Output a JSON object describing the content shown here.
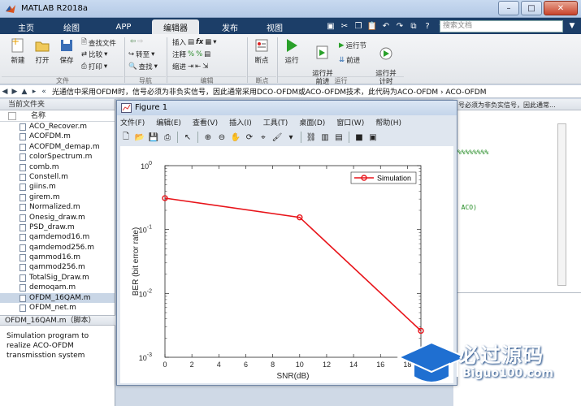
{
  "window": {
    "title": "MATLAB R2018a"
  },
  "tabs": [
    "主页",
    "绘图",
    "APP",
    "编辑器",
    "发布",
    "视图"
  ],
  "search": {
    "placeholder": "搜索文档"
  },
  "ribbon": {
    "new": "新建",
    "open": "打开",
    "save": "保存",
    "find_files": "查找文件",
    "compare": "比较",
    "print": "打印",
    "goto": "转至",
    "find": "查找",
    "insert": "插入",
    "comment": "注释",
    "indent": "缩进",
    "breakpoints": "断点",
    "run": "运行",
    "run_advance": "运行并\n前进",
    "run_section": "运行节",
    "advance": "前进",
    "run_time": "运行并\n计时",
    "groups": {
      "file": "文件",
      "navigate": "导航",
      "edit": "编辑",
      "breakpoints": "断点",
      "run": "运行"
    }
  },
  "address": {
    "path": "光通信中采用OFDM时，信号必须为非负实信号，因此通常采用DCO-OFDM或ACO-OFDM技术，此代码为ACO-OFDM  ›  ACO-OFDM"
  },
  "left_panel": {
    "header": "当前文件夹",
    "column": "名称",
    "files": [
      "ACO_Recover.m",
      "ACOFDM.m",
      "ACOFDM_demap.m",
      "colorSpectrum.m",
      "comb.m",
      "Constell.m",
      "giins.m",
      "girem.m",
      "Normalized.m",
      "Onesig_draw.m",
      "PSD_draw.m",
      "qamdemod16.m",
      "qamdemod256.m",
      "qammod16.m",
      "qammod256.m",
      "TotalSig_Draw.m",
      "demoqam.m",
      "OFDM_16QAM.m",
      "OFDM_net.m"
    ],
    "selected_file": "OFDM_16QAM.m",
    "detail_header": "OFDM_16QAM.m（脚本）",
    "detail_text": "Simulation program to realize ACO-OFDM transmisstion system"
  },
  "editor_bg": {
    "line1": "号必须为非负实信号，因此通常...",
    "line2": "%%%%%%%%%",
    "line3": "c ACO)"
  },
  "figure": {
    "title": "Figure 1",
    "menu": [
      "文件(F)",
      "编辑(E)",
      "查看(V)",
      "插入(I)",
      "工具(T)",
      "桌面(D)",
      "窗口(W)",
      "帮助(H)"
    ]
  },
  "chart_data": {
    "type": "line",
    "x": [
      0,
      10,
      19
    ],
    "series": [
      {
        "name": "Simulation",
        "values": [
          0.31,
          0.155,
          0.0026
        ],
        "color": "#e8141a"
      }
    ],
    "xlabel": "SNR(dB)",
    "ylabel": "BER (bit error rate)",
    "xlim": [
      0,
      19
    ],
    "ylim": [
      0.001,
      1
    ],
    "yscale": "log",
    "xticks": [
      0,
      2,
      4,
      6,
      8,
      10,
      12,
      14,
      16,
      18
    ],
    "yticks": [
      "10^0",
      "10^-1",
      "10^-2",
      "10^-3"
    ],
    "legend": "top-right",
    "grid": false
  },
  "watermark": {
    "brand": "必过源码",
    "site": "Biguo100.com"
  }
}
